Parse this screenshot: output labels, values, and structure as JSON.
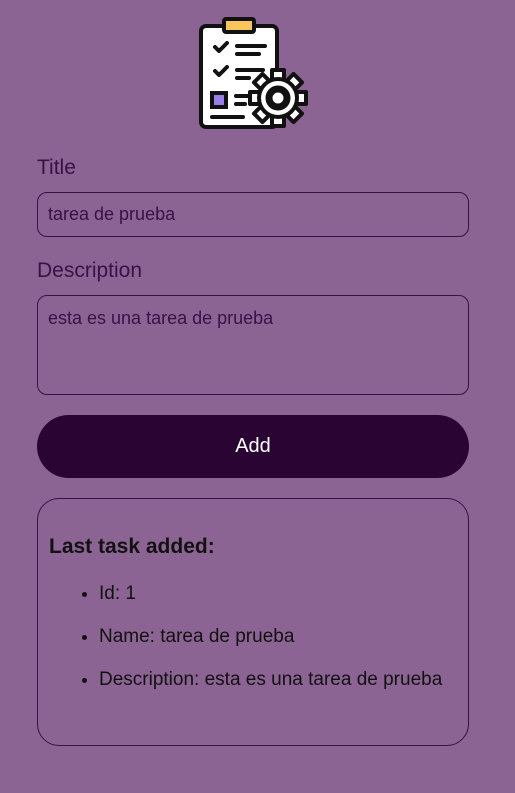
{
  "form": {
    "title_label": "Title",
    "title_value": "tarea de prueba",
    "description_label": "Description",
    "description_value": "esta es una tarea de prueba",
    "add_label": "Add"
  },
  "last_task": {
    "heading": "Last task added:",
    "items": [
      "Id: 1",
      "Name: tarea de prueba",
      "Description: esta es una tarea de prueba"
    ]
  },
  "icons": {
    "logo": "task-checklist-gear-icon"
  },
  "colors": {
    "background": "#8c6494",
    "text_dark": "#3a1046",
    "button": "#2a0533",
    "button_text": "#ffffff",
    "clip": "#f8c65a",
    "checkbox": "#9b7fe8"
  }
}
